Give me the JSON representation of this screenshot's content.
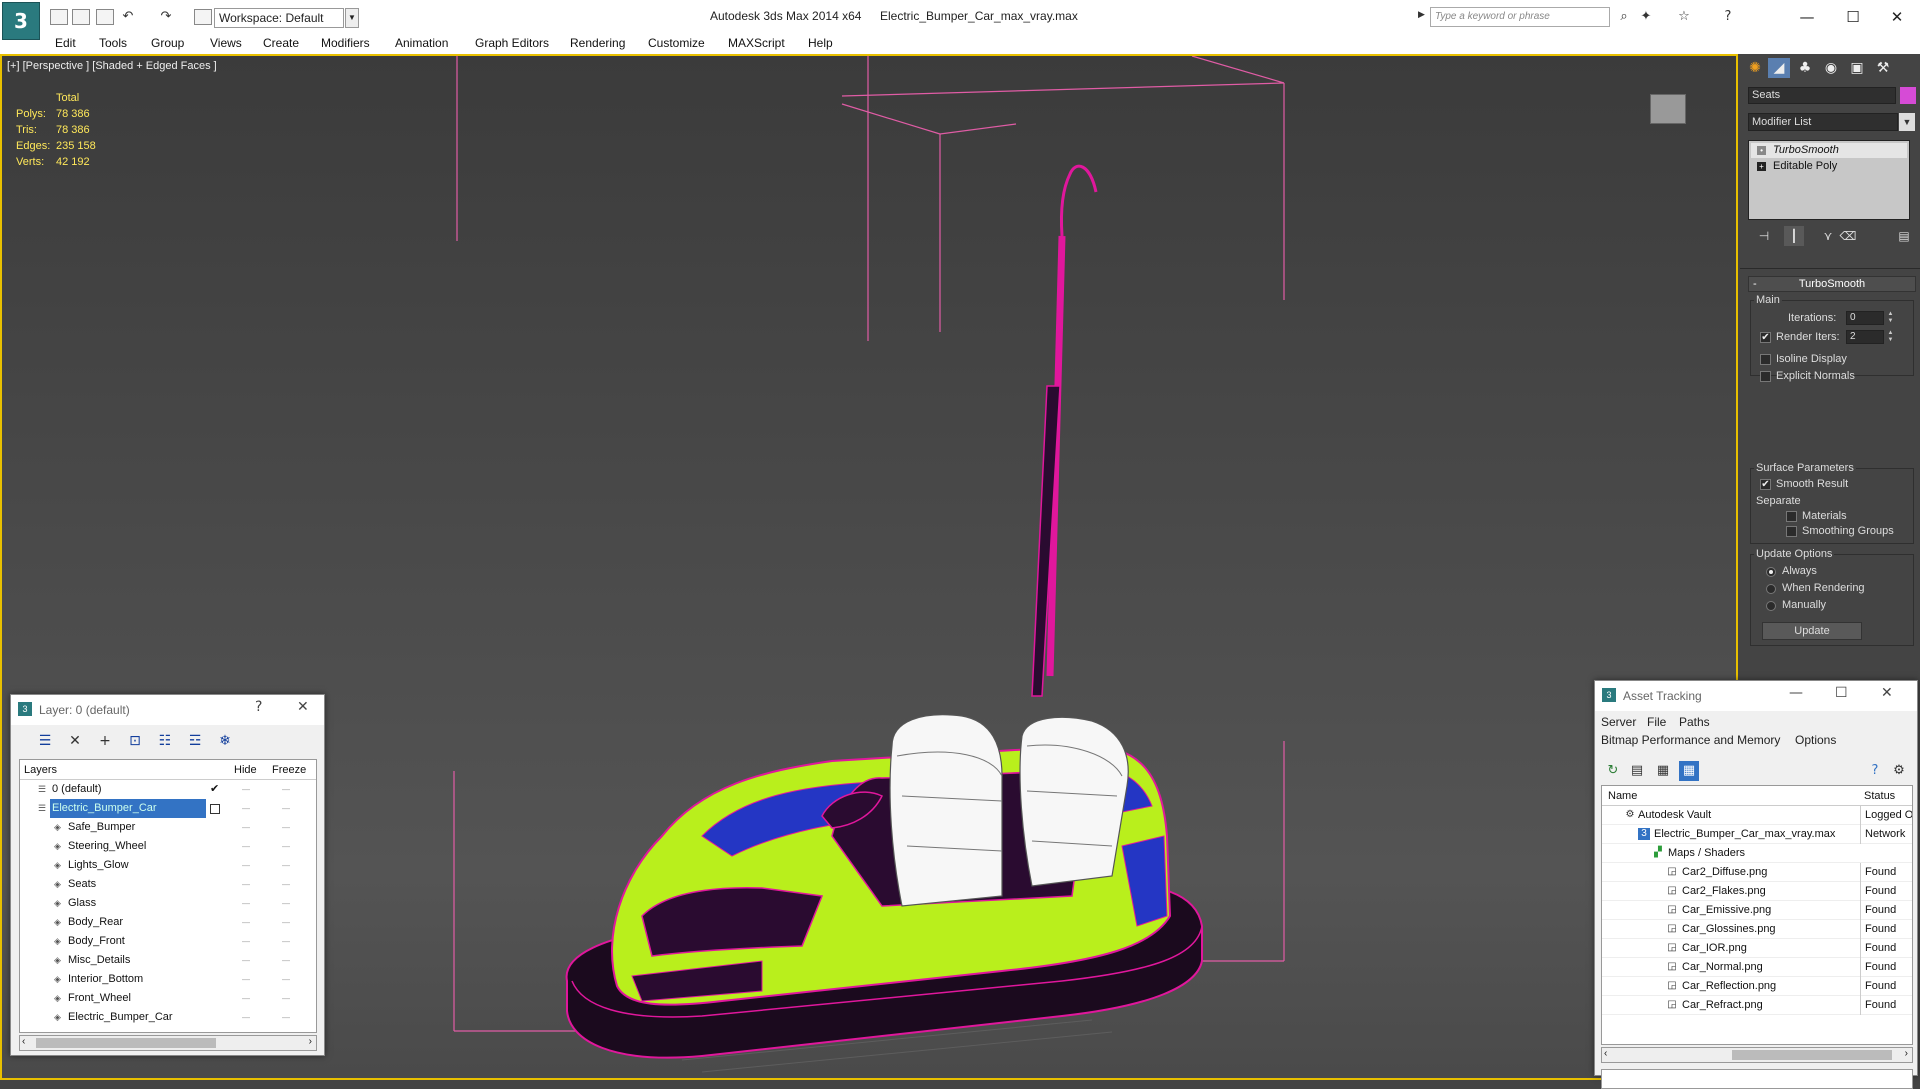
{
  "titlebar": {
    "app": "Autodesk 3ds Max  2014 x64",
    "file": "Electric_Bumper_Car_max_vray.max",
    "workspace": "Workspace: Default",
    "search_placeholder": "Type a keyword or phrase",
    "logo_glyph": "3"
  },
  "menu": [
    "Edit",
    "Tools",
    "Group",
    "Views",
    "Create",
    "Modifiers",
    "Animation",
    "Graph Editors",
    "Rendering",
    "Customize",
    "MAXScript",
    "Help"
  ],
  "viewport": {
    "label": "[+] [Perspective ] [Shaded + Edged Faces ]",
    "stats": {
      "header": "Total",
      "rows": [
        {
          "k": "Polys:",
          "v": "78 386"
        },
        {
          "k": "Tris:",
          "v": "78 386"
        },
        {
          "k": "Edges:",
          "v": "235 158"
        },
        {
          "k": "Verts:",
          "v": "42 192"
        }
      ]
    },
    "wire_color": "#e0179c",
    "body_color": "#b9ef1c",
    "stripe_color": "#2436c4",
    "frame_color": "#e05ca5"
  },
  "command_panel": {
    "object_name": "Seats",
    "object_color": "#d64bd6",
    "modifier_list": "Modifier List",
    "stack": [
      "TurboSmooth",
      "Editable Poly"
    ],
    "rollout": "TurboSmooth",
    "main": {
      "label": "Main",
      "iterations_label": "Iterations:",
      "iterations": "0",
      "render_iters_label": "Render Iters:",
      "render_iters": "2",
      "isoline": "Isoline Display",
      "explicit": "Explicit Normals"
    },
    "surface": {
      "label": "Surface Parameters",
      "smooth": "Smooth Result",
      "separate": "Separate",
      "materials": "Materials",
      "smoothing_groups": "Smoothing Groups"
    },
    "update": {
      "label": "Update Options",
      "always": "Always",
      "when_rendering": "When Rendering",
      "manually": "Manually",
      "button": "Update"
    }
  },
  "layer_window": {
    "title": "Layer: 0 (default)",
    "help": "?",
    "columns": [
      "Layers",
      "Hide",
      "Freeze"
    ],
    "rows": [
      {
        "name": "0 (default)",
        "level": 0
      },
      {
        "name": "Electric_Bumper_Car",
        "level": 0
      },
      {
        "name": "Safe_Bumper",
        "level": 1
      },
      {
        "name": "Steering_Wheel",
        "level": 1
      },
      {
        "name": "Lights_Glow",
        "level": 1
      },
      {
        "name": "Seats",
        "level": 1
      },
      {
        "name": "Glass",
        "level": 1
      },
      {
        "name": "Body_Rear",
        "level": 1
      },
      {
        "name": "Body_Front",
        "level": 1
      },
      {
        "name": "Misc_Details",
        "level": 1
      },
      {
        "name": "Interior_Bottom",
        "level": 1
      },
      {
        "name": "Front_Wheel",
        "level": 1
      },
      {
        "name": "Electric_Bumper_Car",
        "level": 1
      }
    ]
  },
  "asset_window": {
    "title": "Asset Tracking",
    "menu1": [
      "Server",
      "File",
      "Paths"
    ],
    "menu2": [
      "Bitmap Performance and Memory",
      "Options"
    ],
    "columns": [
      "Name",
      "Status"
    ],
    "rows": [
      {
        "name": "Autodesk Vault",
        "status": "Logged Out",
        "level": 0
      },
      {
        "name": "Electric_Bumper_Car_max_vray.max",
        "status": "Network",
        "level": 1
      },
      {
        "name": "Maps / Shaders",
        "status": "",
        "level": 2
      },
      {
        "name": "Car2_Diffuse.png",
        "status": "Found",
        "level": 3
      },
      {
        "name": "Car2_Flakes.png",
        "status": "Found",
        "level": 3
      },
      {
        "name": "Car_Emissive.png",
        "status": "Found",
        "level": 3
      },
      {
        "name": "Car_Glossines.png",
        "status": "Found",
        "level": 3
      },
      {
        "name": "Car_IOR.png",
        "status": "Found",
        "level": 3
      },
      {
        "name": "Car_Normal.png",
        "status": "Found",
        "level": 3
      },
      {
        "name": "Car_Reflection.png",
        "status": "Found",
        "level": 3
      },
      {
        "name": "Car_Refract.png",
        "status": "Found",
        "level": 3
      }
    ]
  }
}
